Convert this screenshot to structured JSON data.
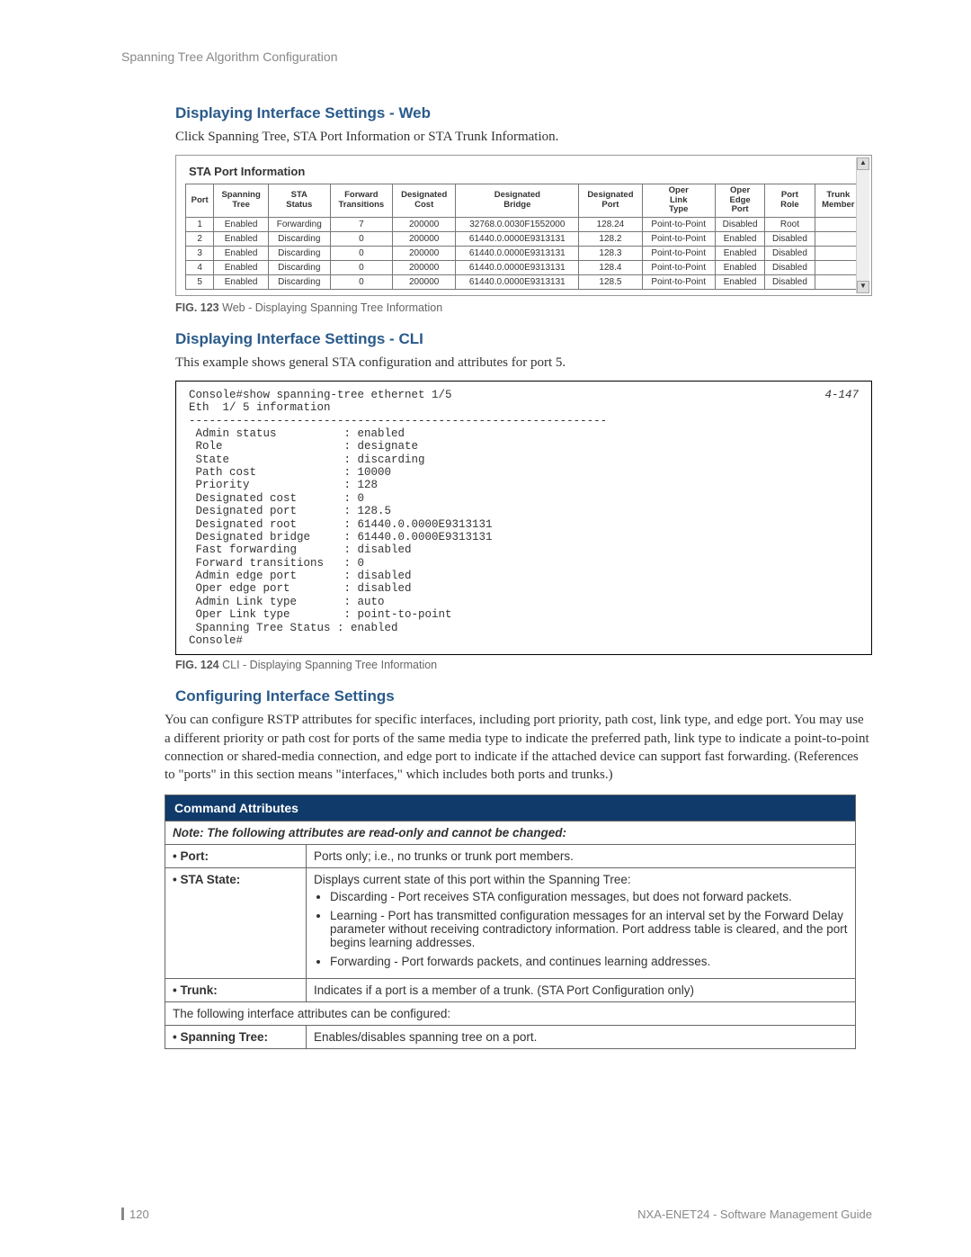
{
  "header": "Spanning Tree Algorithm Configuration",
  "section1": {
    "title": "Displaying Interface Settings - Web",
    "body": "Click Spanning Tree, STA Port Information or STA Trunk Information."
  },
  "sta": {
    "title": "STA Port Information",
    "columns": [
      "Port",
      "Spanning Tree",
      "STA Status",
      "Forward Transitions",
      "Designated Cost",
      "Designated Bridge",
      "Designated Port",
      "Oper Link Type",
      "Oper Edge Port",
      "Port Role",
      "Trunk Member"
    ],
    "rows": [
      [
        "1",
        "Enabled",
        "Forwarding",
        "7",
        "200000",
        "32768.0.0030F1552000",
        "128.24",
        "Point-to-Point",
        "Disabled",
        "Root",
        ""
      ],
      [
        "2",
        "Enabled",
        "Discarding",
        "0",
        "200000",
        "61440.0.0000E9313131",
        "128.2",
        "Point-to-Point",
        "Enabled",
        "Disabled",
        ""
      ],
      [
        "3",
        "Enabled",
        "Discarding",
        "0",
        "200000",
        "61440.0.0000E9313131",
        "128.3",
        "Point-to-Point",
        "Enabled",
        "Disabled",
        ""
      ],
      [
        "4",
        "Enabled",
        "Discarding",
        "0",
        "200000",
        "61440.0.0000E9313131",
        "128.4",
        "Point-to-Point",
        "Enabled",
        "Disabled",
        ""
      ],
      [
        "5",
        "Enabled",
        "Discarding",
        "0",
        "200000",
        "61440.0.0000E9313131",
        "128.5",
        "Point-to-Point",
        "Enabled",
        "Disabled",
        ""
      ]
    ]
  },
  "fig123": {
    "label": "FIG. 123",
    "caption": "Web - Displaying Spanning Tree Information"
  },
  "section2": {
    "title": "Displaying Interface Settings - CLI",
    "body": "This example shows general STA configuration and attributes for port 5."
  },
  "cli": {
    "ref": "4-147",
    "lines": [
      "Console#show spanning-tree ethernet 1/5",
      "Eth  1/ 5 information",
      "--------------------------------------------------------------",
      " Admin status          : enabled",
      " Role                  : designate",
      " State                 : discarding",
      " Path cost             : 10000",
      " Priority              : 128",
      " Designated cost       : 0",
      " Designated port       : 128.5",
      " Designated root       : 61440.0.0000E9313131",
      " Designated bridge     : 61440.0.0000E9313131",
      " Fast forwarding       : disabled",
      " Forward transitions   : 0",
      " Admin edge port       : disabled",
      " Oper edge port        : disabled",
      " Admin Link type       : auto",
      " Oper Link type        : point-to-point",
      " Spanning Tree Status : enabled",
      "Console#"
    ]
  },
  "fig124": {
    "label": "FIG. 124",
    "caption": "CLI - Displaying Spanning Tree Information"
  },
  "section3": {
    "title": "Configuring Interface Settings",
    "body": "You can configure RSTP attributes for specific interfaces, including port priority, path cost, link type, and edge port. You may use a different priority or path cost for ports of the same media type to indicate the preferred path, link type to indicate a point-to-point connection or shared-media connection, and edge port to indicate if the attached device can support fast forwarding. (References to \"ports\" in this section means \"interfaces,\" which includes both ports and trunks.)"
  },
  "cmdAttr": {
    "header": "Command Attributes",
    "note": "Note: The following attributes are read-only and cannot be changed:",
    "rows": {
      "port_label": "• Port:",
      "port_desc": "Ports only; i.e., no trunks or trunk port members.",
      "sta_label": "• STA State:",
      "sta_desc_intro": "Displays current state of this port within the Spanning Tree:",
      "sta_bullets": [
        "Discarding - Port receives STA configuration messages, but does not forward packets.",
        "Learning - Port has transmitted configuration messages for an interval set by the Forward Delay parameter without receiving contradictory information. Port address table is cleared, and the port begins learning addresses.",
        "Forwarding - Port forwards packets, and continues learning addresses."
      ],
      "trunk_label": "• Trunk:",
      "trunk_desc": "Indicates if a port is a member of a trunk. (STA Port Configuration only)",
      "configurable_note": "The following interface attributes can be configured:",
      "st_label": "• Spanning Tree:",
      "st_desc": "Enables/disables spanning tree on a port."
    }
  },
  "footer": {
    "page": "120",
    "doc": "NXA-ENET24 - Software Management Guide"
  }
}
